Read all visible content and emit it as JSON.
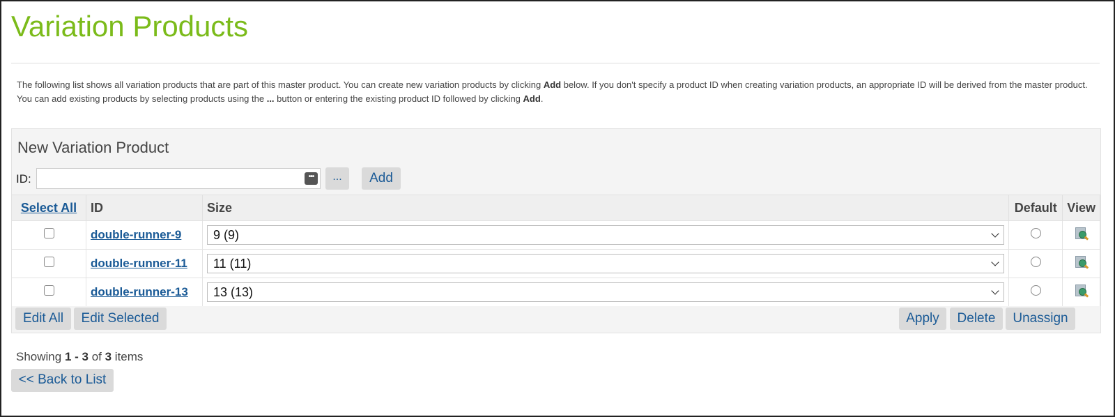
{
  "page": {
    "title": "Variation Products",
    "intro": {
      "part1": "The following list shows all variation products that are part of this master product. You can create new variation products by clicking ",
      "bold1": "Add",
      "part2": " below. If you don't specify a product ID when creating variation products, an appropriate ID will be derived from the master product. You can add existing products by selecting products using the ",
      "bold2": "...",
      "part3": " button or entering the existing product ID followed by clicking ",
      "bold3": "Add",
      "part4": "."
    }
  },
  "new_variation": {
    "title": "New Variation Product",
    "id_label": "ID:",
    "id_value": "",
    "id_placeholder": "",
    "input_icon": "more-dots-icon",
    "browse_label": "...",
    "add_label": "Add"
  },
  "table": {
    "columns": {
      "select_all": "Select All",
      "id": "ID",
      "size": "Size",
      "default": "Default",
      "view": "View"
    },
    "rows": [
      {
        "id": "double-runner-9",
        "size": "9 (9)",
        "checked": false,
        "default": false,
        "view_icon": "preview-magnifier-icon"
      },
      {
        "id": "double-runner-11",
        "size": "11 (11)",
        "checked": false,
        "default": false,
        "view_icon": "preview-magnifier-icon"
      },
      {
        "id": "double-runner-13",
        "size": "13 (13)",
        "checked": false,
        "default": false,
        "view_icon": "preview-magnifier-icon"
      }
    ],
    "actions": {
      "edit_all": "Edit All",
      "edit_selected": "Edit Selected",
      "apply": "Apply",
      "delete": "Delete",
      "unassign": "Unassign"
    }
  },
  "pagination": {
    "prefix": "Showing ",
    "from": "1",
    "sep": " - ",
    "to": "3",
    "of": " of ",
    "total": "3",
    "suffix": " items"
  },
  "back_button": "<< Back to List",
  "colors": {
    "title": "#7bbb1a",
    "link": "#1a5a96",
    "button_bg": "#dadada",
    "panel_bg": "#f4f4f4"
  }
}
